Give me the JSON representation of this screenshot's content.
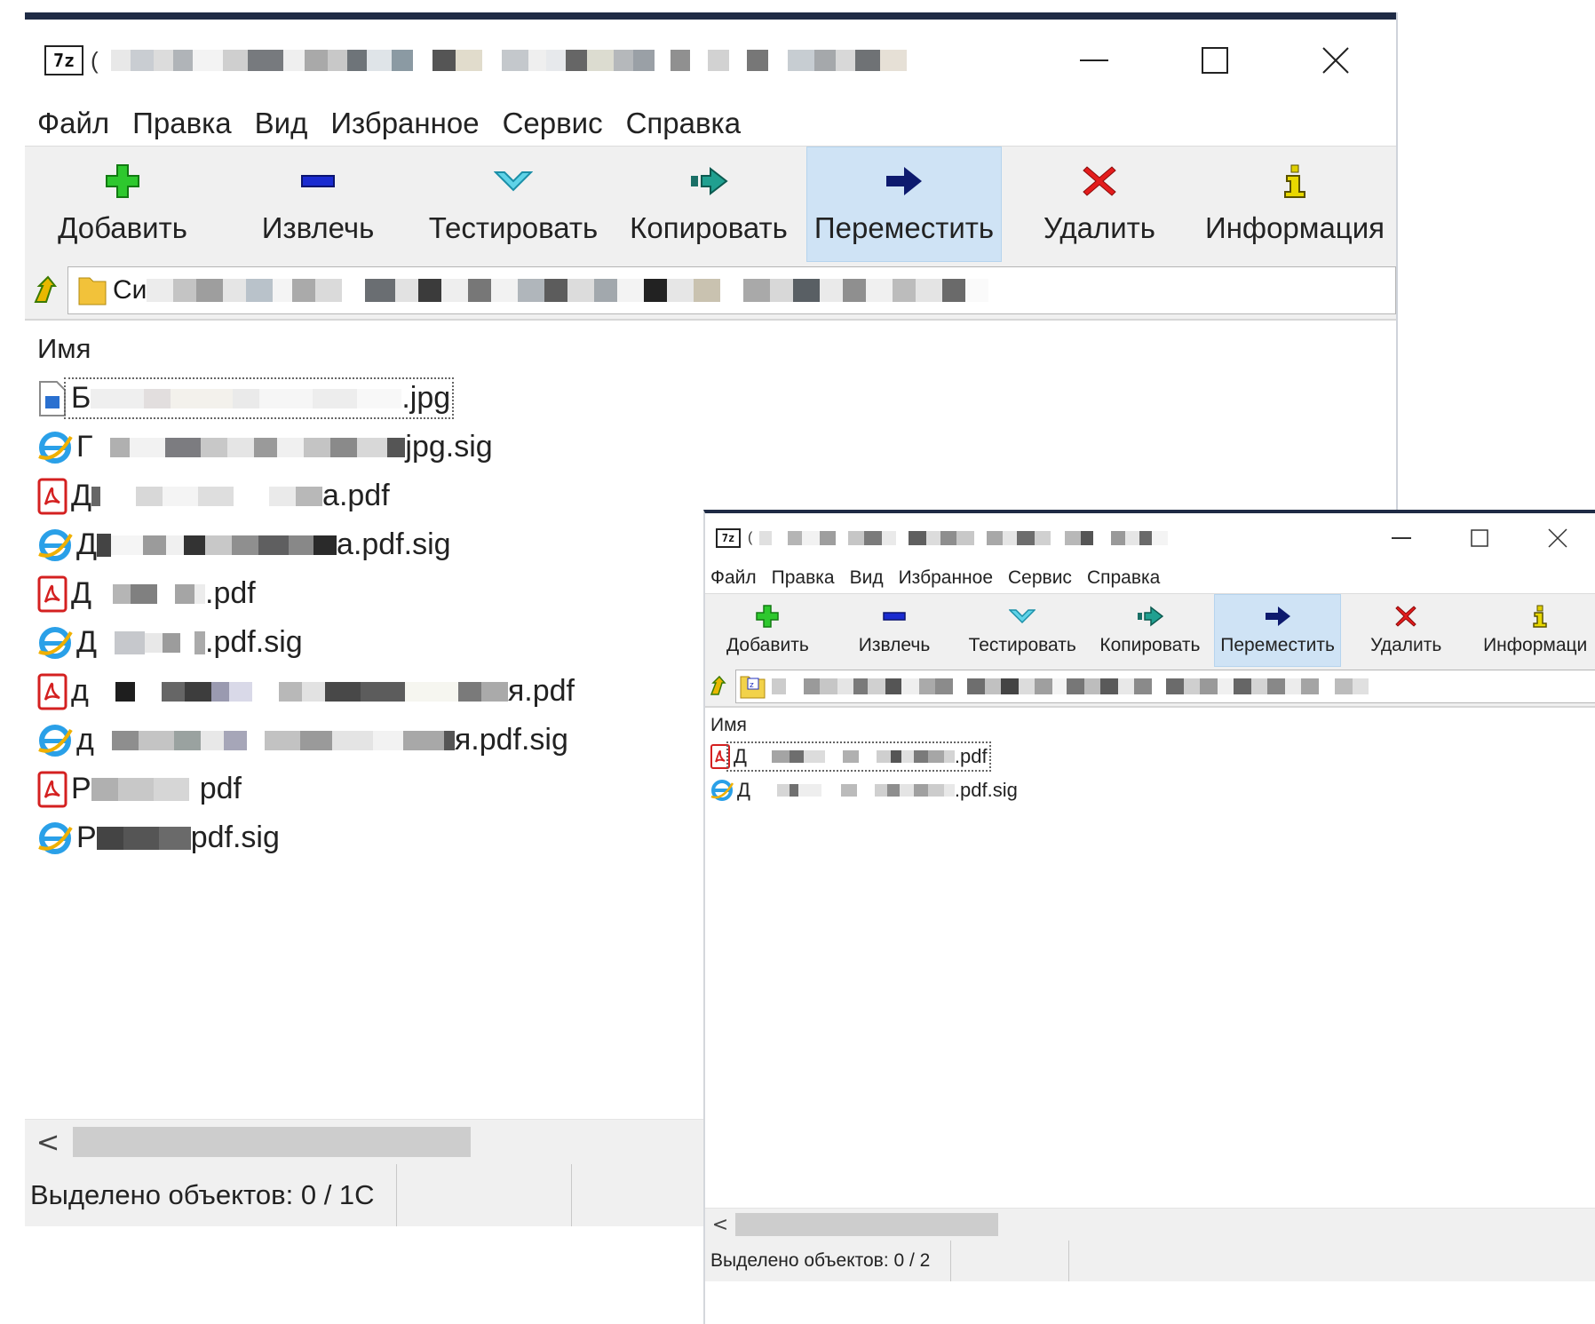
{
  "win1": {
    "title_start": "(",
    "menu": [
      "Файл",
      "Правка",
      "Вид",
      "Избранное",
      "Сервис",
      "Справка"
    ],
    "toolbar": [
      {
        "label": "Добавить",
        "icon": "add-icon",
        "color": "#22bb22"
      },
      {
        "label": "Извлечь",
        "icon": "extract-icon",
        "color": "#1a2bb8"
      },
      {
        "label": "Тестировать",
        "icon": "test-icon",
        "color": "#28b4cc"
      },
      {
        "label": "Копировать",
        "icon": "copy-icon",
        "color": "#1a8a7a"
      },
      {
        "label": "Переместить",
        "icon": "move-icon",
        "color": "#0d1a6e"
      },
      {
        "label": "Удалить",
        "icon": "delete-icon",
        "color": "#e01b1b"
      },
      {
        "label": "Информация",
        "icon": "info-icon",
        "color": "#b8a400"
      }
    ],
    "path_start": "Си",
    "column_header": "Имя",
    "files": [
      {
        "start": "Б",
        "end": ".jpg",
        "type": "image"
      },
      {
        "start": "Г",
        "end": "jpg.sig",
        "type": "sig"
      },
      {
        "start": "Д",
        "end": "a.pdf",
        "type": "pdf"
      },
      {
        "start": "Д",
        "end": "a.pdf.sig",
        "type": "sig"
      },
      {
        "start": "Д",
        "end": ".pdf",
        "type": "pdf"
      },
      {
        "start": "Д",
        "end": ".pdf.sig",
        "type": "sig"
      },
      {
        "start": "д",
        "end": "я.pdf",
        "type": "pdf"
      },
      {
        "start": "д",
        "end": "я.pdf.sig",
        "type": "sig"
      },
      {
        "start": "Р",
        "end": "pdf",
        "type": "pdf"
      },
      {
        "start": "Р",
        "end": "pdf.sig",
        "type": "sig"
      }
    ],
    "status": "Выделено объектов: 0 / 1С",
    "scroll_left": "<"
  },
  "win2": {
    "title_start": "(",
    "menu": [
      "Файл",
      "Правка",
      "Вид",
      "Избранное",
      "Сервис",
      "Справка"
    ],
    "toolbar": [
      {
        "label": "Добавить",
        "icon": "add-icon",
        "color": "#22bb22"
      },
      {
        "label": "Извлечь",
        "icon": "extract-icon",
        "color": "#1a2bb8"
      },
      {
        "label": "Тестировать",
        "icon": "test-icon",
        "color": "#28b4cc"
      },
      {
        "label": "Копировать",
        "icon": "copy-icon",
        "color": "#1a8a7a"
      },
      {
        "label": "Переместить",
        "icon": "move-icon",
        "color": "#0d1a6e"
      },
      {
        "label": "Удалить",
        "icon": "delete-icon",
        "color": "#e01b1b"
      },
      {
        "label": "Информаци",
        "icon": "info-icon",
        "color": "#b8a400"
      }
    ],
    "column_header": "Имя",
    "files": [
      {
        "start": "Д",
        "end": ".pdf",
        "type": "pdf"
      },
      {
        "start": "Д",
        "end": ".pdf.sig",
        "type": "sig"
      }
    ],
    "status": "Выделено объектов: 0 / 2",
    "scroll_left": "<"
  },
  "app_icon_label": "7z"
}
